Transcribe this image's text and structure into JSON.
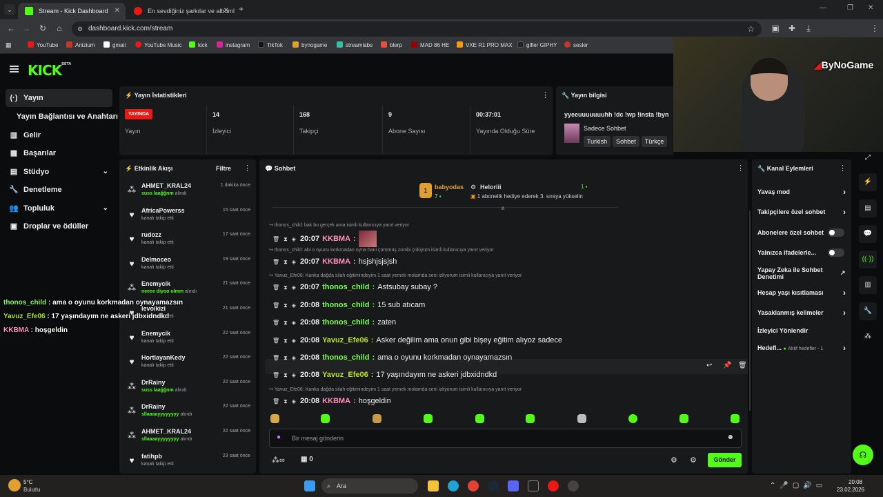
{
  "browser": {
    "tabs": [
      {
        "label": "Stream - Kick Dashboard"
      },
      {
        "label": "En sevdiğiniz şarkılar ve albümle"
      }
    ],
    "url": "dashboard.kick.com/stream",
    "bookmarks": [
      "YouTube",
      "Anizium",
      "gmail",
      "YouTube Music",
      "kick",
      "instagram",
      "TikTok",
      "bynogame",
      "streamlabs",
      "blerp",
      "MAD 86 HE",
      "VXE R1 PRO MAX",
      "gifler GIPHY",
      "sesler"
    ]
  },
  "app": {
    "logo": "KICK",
    "logo_sup": "BETA",
    "sidebar": [
      {
        "label": "Yayın",
        "icon": "(·)"
      },
      {
        "label": "Yayın Bağlantısı ve Anahtarı",
        "icon": ""
      },
      {
        "label": "Gelir",
        "icon": "▥"
      },
      {
        "label": "Başarılar",
        "icon": "▦"
      },
      {
        "label": "Stüdyo",
        "icon": "▤"
      },
      {
        "label": "Denetleme",
        "icon": "🔧"
      },
      {
        "label": "Topluluk",
        "icon": "👥"
      },
      {
        "label": "Droplar ve ödüller",
        "icon": "▣"
      }
    ],
    "stats": {
      "title": "Yayın İstatistikleri",
      "live_badge": "YAYINDA",
      "items": [
        {
          "value": "",
          "label": "Yayın"
        },
        {
          "value": "14",
          "label": "İzleyici"
        },
        {
          "value": "168",
          "label": "Takipçi"
        },
        {
          "value": "9",
          "label": "Abone Sayısı"
        },
        {
          "value": "00:37:01",
          "label": "Yayında Olduğu Süre"
        }
      ]
    },
    "stream_info": {
      "title": "Yayın bilgisi",
      "stream_title": "yyeeuuuuuuuhh !dc !wp !insta !byn",
      "category": "Sadece Sohbet",
      "tags": [
        "Turkish",
        "Sohbet",
        "Türkçe"
      ]
    },
    "activity": {
      "title": "Etkinlik Akışı",
      "filter": "Filtre",
      "items": [
        {
          "name": "AHMET_KRAL24",
          "highlight": "suss laağğnm",
          "detail": " alındı",
          "time": "1 dakika önce"
        },
        {
          "name": "AfricaPowerss",
          "highlight": "",
          "detail": "kanalı takip etti",
          "time": "15 saat önce"
        },
        {
          "name": "rudozz",
          "highlight": "",
          "detail": "kanalı takip etti",
          "time": "17 saat önce"
        },
        {
          "name": "Delmoceo",
          "highlight": "",
          "detail": "kanalı takip etti",
          "time": "19 saat önce"
        },
        {
          "name": "Enemycik",
          "highlight": "neeee diyoo olmm",
          "detail": " alındı",
          "time": "21 saat önce"
        },
        {
          "name": "levoikizi",
          "highlight": "",
          "detail": "kanalı takip etti",
          "time": "21 saat önce"
        },
        {
          "name": "Enemycik",
          "highlight": "",
          "detail": "kanalı takip etti",
          "time": "22 saat önce"
        },
        {
          "name": "HortlayanKedy",
          "highlight": "",
          "detail": "kanalı takip etti",
          "time": "22 saat önce"
        },
        {
          "name": "DrRainy",
          "highlight": "suss laağğnm",
          "detail": " alındı",
          "time": "22 saat önce"
        },
        {
          "name": "DrRainy",
          "highlight": "sllaaaayyyyyyyy",
          "detail": " alındı",
          "time": "22 saat önce"
        },
        {
          "name": "AHMET_KRAL24",
          "highlight": "sllaaaayyyyyyyy",
          "detail": " alındı",
          "time": "22 saat önce"
        },
        {
          "name": "fatihpb",
          "highlight": "",
          "detail": "kanalı takip etti",
          "time": "23 saat önce"
        }
      ]
    },
    "chat": {
      "title": "Sohbet",
      "pinned_top": {
        "name": "babyodas",
        "count": "7",
        "badge": "1"
      },
      "pinned_gift": {
        "name": "Heloriii",
        "text": "1 abonelik hediye ederek 3. sıraya yükselin",
        "count": "1"
      },
      "messages": [
        {
          "reply": "thonos_child: bak bu gerçek ama isimli kullanıcıya yanıt veriyor",
          "time": "20:07",
          "user": "KKBMA",
          "text": "",
          "color": "#ff8fbf",
          "image": true
        },
        {
          "reply": "thonos_child: abi o oyunu korkmadan oyna hani çürümüş zombi çükiyüm isimli kullanıcıya yanıt veriyor",
          "time": "20:07",
          "user": "KKBMA",
          "text": "hsjshjsjsjsh",
          "color": "#ff8fbf"
        },
        {
          "reply": "Yavuz_Efe06: Kanka dağda silah eğitimindeyim 1 saat yemek molamda seni izliyorum isimli kullanıcıya yanıt veriyor",
          "time": "20:07",
          "user": "thonos_child",
          "text": "Astsubay subay ?",
          "color": "#7cff4f"
        },
        {
          "reply": "",
          "time": "20:08",
          "user": "thonos_child",
          "text": "15 sub atıcam",
          "color": "#7cff4f"
        },
        {
          "reply": "",
          "time": "20:08",
          "user": "thonos_child",
          "text": "zaten",
          "color": "#7cff4f"
        },
        {
          "reply": "",
          "time": "20:08",
          "user": "Yavuz_Efe06",
          "text": "Asker değilim ama onun gibi bişey eğitim alıyoz sadece",
          "color": "#b5e61d"
        },
        {
          "reply": "",
          "time": "20:08",
          "user": "thonos_child",
          "text": "ama o oyunu korkmadan oynayamazsın",
          "color": "#7cff4f"
        },
        {
          "reply": "",
          "time": "20:08",
          "user": "Yavuz_Efe06",
          "text": "17 yaşındayım ne askeri jdbxidndkd",
          "color": "#b5e61d"
        },
        {
          "reply": "Yavuz_Efe06: Kanka dağda silah eğitimindeyim 1 saat yemek molamda seni izliyorum isimli kullanıcıya yanıt veriyor",
          "time": "20:08",
          "user": "KKBMA",
          "text": "hoşgeldin",
          "color": "#ff8fbf"
        }
      ],
      "input_placeholder": "Bir mesaj gönderin",
      "points": "0",
      "send": "Gönder"
    },
    "channel_actions": {
      "title": "Kanal Eylemleri",
      "items": [
        {
          "label": "Yavaş mod",
          "kind": "chev"
        },
        {
          "label": "Takipçilere özel sohbet",
          "kind": "chev"
        },
        {
          "label": "Abonelere özel sohbet",
          "kind": "toggle"
        },
        {
          "label": "Yalnızca ifadelerle...",
          "kind": "toggle"
        },
        {
          "label": "Yapay Zeka ile Sohbet Denetimi",
          "kind": "ext"
        },
        {
          "label": "Hesap yaşı kısıtlaması",
          "kind": "chev"
        },
        {
          "label": "Yasaklanmış kelimeler",
          "kind": "chev"
        },
        {
          "label": "İzleyici Yönlendir",
          "kind": "none"
        },
        {
          "label": "Hedefl...",
          "kind": "chev",
          "extra": "Aktif hedefler - 1"
        }
      ]
    },
    "overlay": [
      {
        "user": "thonos_child",
        "text": " : ama o oyunu korkmadan oynayamazsın",
        "color": "#7cff4f"
      },
      {
        "user": "Yavuz_Efe06",
        "text": " : 17 yaşındayım ne askeri jdbxidndkd",
        "color": "#b5e61d"
      },
      {
        "user": "KKBMA",
        "text": " : hoşgeldin",
        "color": "#ff8fbf"
      }
    ],
    "watermark": "ByNoGame"
  },
  "taskbar": {
    "weather_temp": "5°C",
    "weather_desc": "Bulutlu",
    "search": "Ara",
    "time": "20:08",
    "date": "23.02.2026"
  },
  "colors": {
    "accent": "#53fc18",
    "live": "#e91916",
    "panel": "#18191b"
  }
}
